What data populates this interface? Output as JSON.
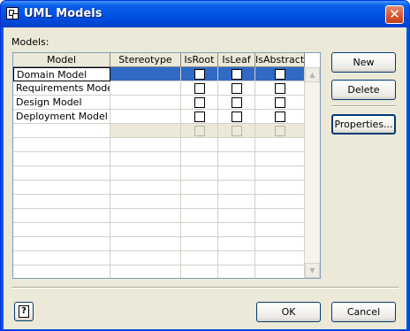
{
  "window": {
    "title": "UML Models",
    "close_glyph": "✕"
  },
  "models_label": "Models:",
  "grid": {
    "columns": [
      "Model",
      "Stereotype",
      "IsRoot",
      "IsLeaf",
      "IsAbstract"
    ],
    "rows": [
      {
        "model": "Domain Model",
        "stereotype": "",
        "selected": true
      },
      {
        "model": "Requirements Model",
        "stereotype": ""
      },
      {
        "model": "Design Model",
        "stereotype": ""
      },
      {
        "model": "Deployment Model",
        "stereotype": ""
      }
    ]
  },
  "buttons": {
    "new": "New",
    "delete": "Delete",
    "properties": "Properties...",
    "ok": "OK",
    "cancel": "Cancel"
  },
  "help_glyph": "?",
  "colors": {
    "title_bar": "#0054e3",
    "selection": "#316ac5",
    "dialog_bg": "#ece9d8"
  }
}
